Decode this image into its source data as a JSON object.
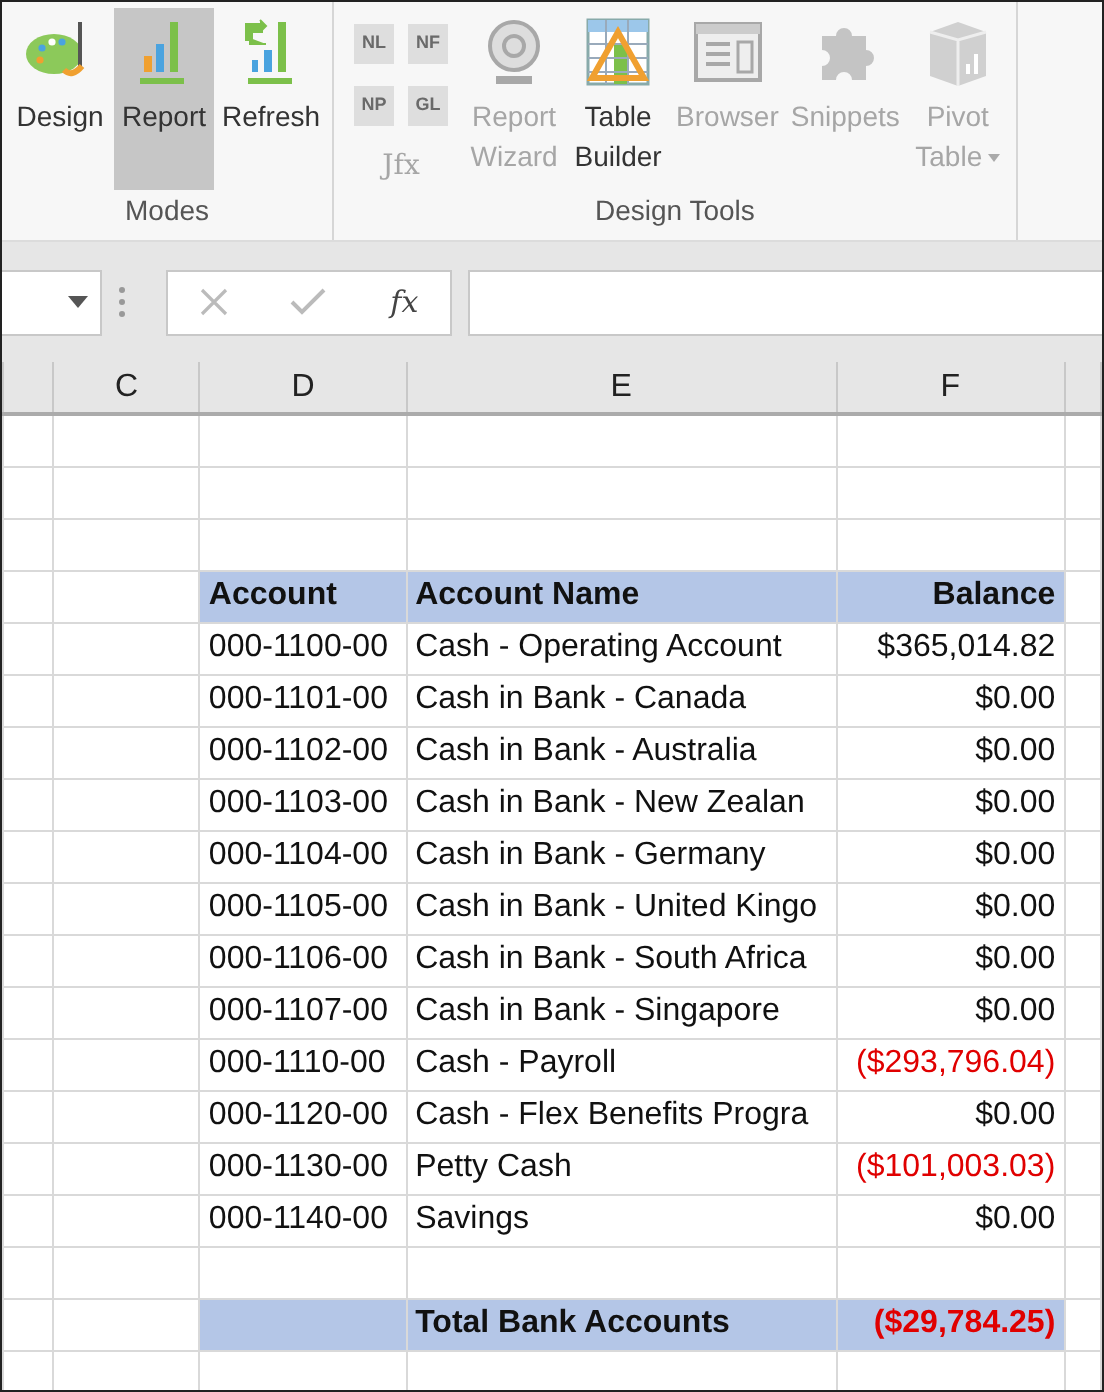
{
  "ribbon": {
    "groups": [
      {
        "label": "Modes",
        "buttons": [
          {
            "kind": "design",
            "lines": [
              "Design"
            ],
            "selected": false,
            "disabled": false
          },
          {
            "kind": "report",
            "lines": [
              "Report"
            ],
            "selected": true,
            "disabled": false
          },
          {
            "kind": "refresh",
            "lines": [
              "Refresh"
            ],
            "selected": false,
            "disabled": false
          }
        ]
      },
      {
        "label": "Design Tools",
        "small_buttons": [
          {
            "label": "NL",
            "disabled": true
          },
          {
            "label": "NF",
            "disabled": true
          },
          {
            "label": "NP",
            "disabled": true
          },
          {
            "label": "GL",
            "disabled": true
          }
        ],
        "small_caption": "Jfx",
        "buttons": [
          {
            "kind": "wizard",
            "lines": [
              "Report",
              "Wizard"
            ],
            "selected": false,
            "disabled": true
          },
          {
            "kind": "table",
            "lines": [
              "Table",
              "Builder"
            ],
            "selected": false,
            "disabled": false
          },
          {
            "kind": "browser",
            "lines": [
              "Browser"
            ],
            "selected": false,
            "disabled": true
          },
          {
            "kind": "snippets",
            "lines": [
              "Snippets"
            ],
            "selected": false,
            "disabled": true
          },
          {
            "kind": "pivot",
            "lines": [
              "Pivot",
              "Table"
            ],
            "selected": false,
            "disabled": true,
            "has_menu": true
          }
        ]
      }
    ]
  },
  "formula_bar": {
    "function_label": "fx"
  },
  "columns": [
    "C",
    "D",
    "E",
    "F"
  ],
  "rows": [
    {
      "kind": "blank"
    },
    {
      "kind": "blank"
    },
    {
      "kind": "blank"
    },
    {
      "kind": "header",
      "account": "Account",
      "name": "Account Name",
      "balance": "Balance"
    },
    {
      "kind": "data",
      "account": "000-1100-00",
      "name": "Cash - Operating Account",
      "balance": "$365,014.82",
      "negative": false
    },
    {
      "kind": "data",
      "account": "000-1101-00",
      "name": "Cash in Bank - Canada",
      "balance": "$0.00",
      "negative": false
    },
    {
      "kind": "data",
      "account": "000-1102-00",
      "name": "Cash in Bank - Australia",
      "balance": "$0.00",
      "negative": false
    },
    {
      "kind": "data",
      "account": "000-1103-00",
      "name": "Cash in Bank - New Zealan",
      "balance": "$0.00",
      "negative": false
    },
    {
      "kind": "data",
      "account": "000-1104-00",
      "name": "Cash in Bank - Germany",
      "balance": "$0.00",
      "negative": false
    },
    {
      "kind": "data",
      "account": "000-1105-00",
      "name": "Cash in Bank - United Kingo",
      "balance": "$0.00",
      "negative": false
    },
    {
      "kind": "data",
      "account": "000-1106-00",
      "name": "Cash in Bank - South Africa",
      "balance": "$0.00",
      "negative": false
    },
    {
      "kind": "data",
      "account": "000-1107-00",
      "name": "Cash in Bank - Singapore",
      "balance": "$0.00",
      "negative": false
    },
    {
      "kind": "data",
      "account": "000-1110-00",
      "name": "Cash - Payroll",
      "balance": "($293,796.04)",
      "negative": true
    },
    {
      "kind": "data",
      "account": "000-1120-00",
      "name": "Cash - Flex Benefits Progra",
      "balance": "$0.00",
      "negative": false
    },
    {
      "kind": "data",
      "account": "000-1130-00",
      "name": "Petty Cash",
      "balance": "($101,003.03)",
      "negative": true
    },
    {
      "kind": "data",
      "account": "000-1140-00",
      "name": "Savings",
      "balance": "$0.00",
      "negative": false
    },
    {
      "kind": "blank"
    },
    {
      "kind": "total",
      "name": "Total Bank Accounts",
      "balance": "($29,784.25)",
      "negative": true
    },
    {
      "kind": "blank"
    }
  ]
}
